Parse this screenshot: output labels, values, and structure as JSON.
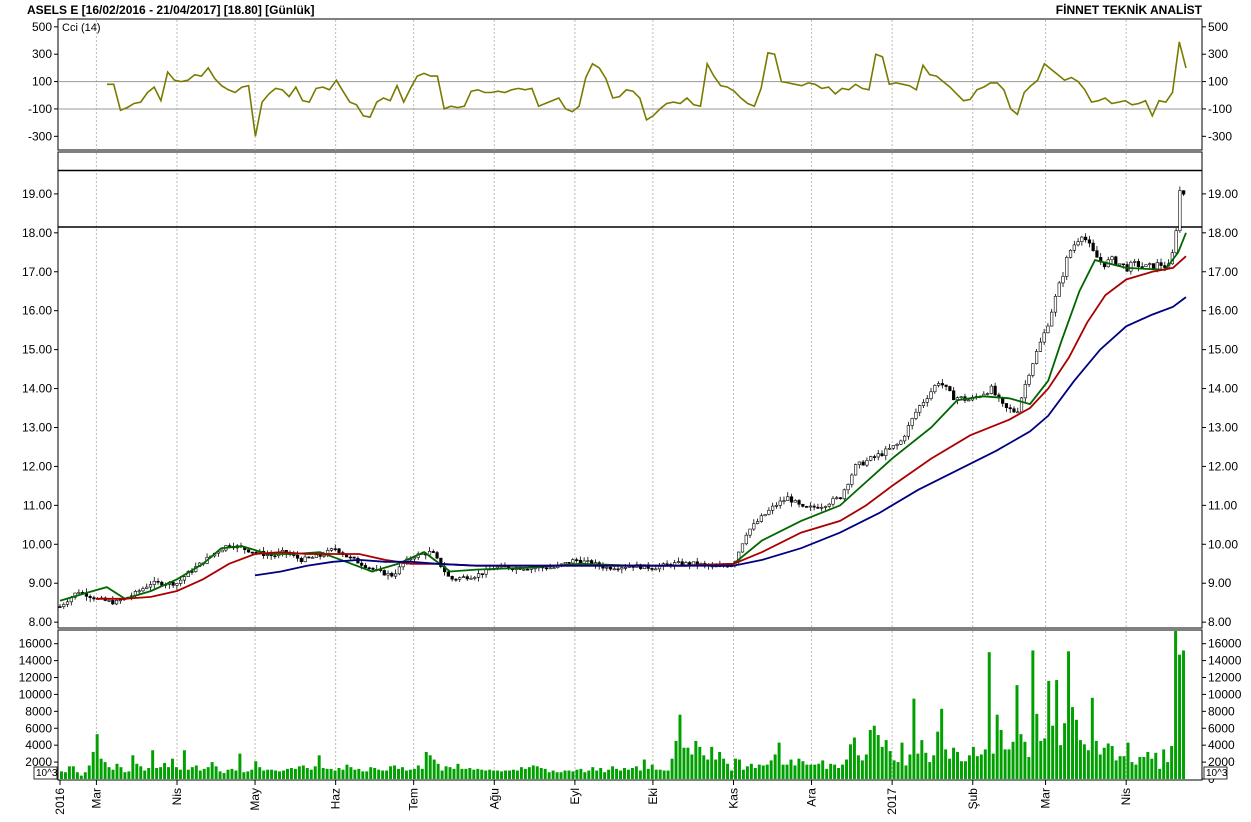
{
  "header": {
    "title": "ASELS E  [16/02/2016 - 21/04/2017]  [18.80]  [Günlük]",
    "brand": "FİNNET TEKNİK ANALİST"
  },
  "chart_data": [
    {
      "type": "line",
      "title": "Cci (14)",
      "y_ticks": [
        "500",
        "300",
        "100",
        "-100",
        "-300"
      ],
      "ylim": [
        -400,
        550
      ],
      "reference_lines": [
        100,
        -100
      ],
      "series": [
        {
          "name": "Cci (14)",
          "color": "#7a7a00",
          "values": [
            80,
            80,
            -110,
            -90,
            -60,
            -50,
            20,
            60,
            -40,
            170,
            110,
            100,
            110,
            150,
            140,
            200,
            120,
            70,
            40,
            20,
            60,
            70,
            -300,
            -50,
            10,
            50,
            40,
            -10,
            60,
            -40,
            -50,
            50,
            60,
            40,
            110,
            30,
            -50,
            -70,
            -150,
            -160,
            -50,
            -20,
            -40,
            70,
            -50,
            50,
            140,
            160,
            140,
            140,
            -100,
            -80,
            -90,
            -80,
            30,
            40,
            20,
            20,
            30,
            20,
            40,
            50,
            40,
            50,
            -80,
            -60,
            -40,
            -20,
            -100,
            -120,
            -80,
            130,
            230,
            200,
            120,
            -20,
            -10,
            40,
            30,
            -20,
            -180,
            -150,
            -100,
            -60,
            -50,
            -60,
            -20,
            -70,
            -80,
            230,
            140,
            70,
            60,
            30,
            -20,
            -60,
            -80,
            50,
            310,
            300,
            100,
            90,
            80,
            70,
            90,
            80,
            50,
            60,
            10,
            50,
            40,
            80,
            50,
            40,
            300,
            280,
            80,
            90,
            80,
            70,
            40,
            220,
            150,
            140,
            100,
            60,
            10,
            -40,
            -30,
            40,
            60,
            90,
            90,
            40,
            -100,
            -140,
            20,
            70,
            110,
            230,
            190,
            150,
            110,
            130,
            100,
            40,
            -50,
            -40,
            -20,
            -60,
            -50,
            -40,
            -70,
            -60,
            -40,
            -150,
            -40,
            -50,
            20,
            390,
            200
          ]
        }
      ]
    },
    {
      "type": "line",
      "y_ticks": [
        "19.00",
        "18.00",
        "17.00",
        "16.00",
        "15.00",
        "14.00",
        "13.00",
        "12.00",
        "11.00",
        "10.00",
        "9.00",
        "8.00"
      ],
      "ylim": [
        7.85,
        20.05
      ],
      "x_tick_labels": [
        "2016",
        "Mar",
        "Nis",
        "May",
        "Haz",
        "Tem",
        "Ağu",
        "Eyl",
        "Eki",
        "Kas",
        "Ara",
        "2017",
        "Şub",
        "Mar",
        "Nis"
      ],
      "x_tick_days": [
        0,
        14,
        45,
        75,
        106,
        136,
        167,
        198,
        228,
        259,
        289,
        320,
        351,
        379,
        410
      ],
      "horizontal_lines": [
        19.6,
        18.15
      ],
      "close_series": {
        "days": [
          0,
          7,
          14,
          21,
          28,
          35,
          45,
          50,
          60,
          65,
          70,
          75,
          82,
          86,
          93,
          100,
          106,
          110,
          116,
          122,
          128,
          132,
          136,
          143,
          150,
          160,
          167,
          175,
          182,
          190,
          198,
          205,
          210,
          220,
          228,
          236,
          245,
          252,
          259,
          264,
          270,
          275,
          280,
          286,
          293,
          300,
          306,
          312,
          318,
          323,
          330,
          338,
          343,
          350,
          358,
          363,
          368,
          373,
          379,
          385,
          388,
          393,
          397,
          401,
          405,
          410,
          414,
          418,
          423,
          427,
          429,
          431,
          433
        ],
        "values": [
          8.4,
          8.8,
          8.6,
          8.5,
          8.7,
          9.0,
          9.0,
          9.3,
          9.8,
          10.0,
          9.9,
          9.8,
          9.7,
          9.8,
          9.6,
          9.7,
          9.9,
          9.7,
          9.5,
          9.3,
          9.2,
          9.5,
          9.7,
          9.8,
          9.1,
          9.2,
          9.4,
          9.4,
          9.4,
          9.4,
          9.6,
          9.5,
          9.4,
          9.45,
          9.4,
          9.5,
          9.5,
          9.4,
          9.5,
          10.3,
          10.7,
          11.0,
          11.2,
          10.9,
          11.0,
          11.2,
          12.0,
          12.2,
          12.4,
          12.6,
          13.5,
          14.2,
          13.8,
          13.7,
          14.0,
          13.5,
          13.4,
          14.5,
          15.5,
          16.8,
          17.5,
          18.0,
          17.5,
          17.2,
          17.3,
          17.1,
          17.2,
          17.1,
          17.2,
          17.1,
          18.0,
          19.3,
          18.8
        ]
      },
      "ma_series": [
        {
          "name": "",
          "color": "#006600",
          "days": [
            0,
            10,
            18,
            25,
            35,
            45,
            55,
            62,
            70,
            80,
            90,
            100,
            110,
            120,
            130,
            140,
            150,
            160,
            180,
            200,
            220,
            240,
            259,
            270,
            285,
            300,
            310,
            320,
            335,
            345,
            355,
            365,
            373,
            380,
            385,
            392,
            398,
            410,
            425,
            430,
            433
          ],
          "values": [
            8.55,
            8.75,
            8.9,
            8.6,
            8.8,
            9.1,
            9.5,
            9.9,
            9.95,
            9.75,
            9.75,
            9.8,
            9.55,
            9.3,
            9.5,
            9.8,
            9.3,
            9.35,
            9.4,
            9.5,
            9.45,
            9.45,
            9.5,
            10.1,
            10.6,
            11.0,
            11.6,
            12.2,
            13.0,
            13.7,
            13.8,
            13.75,
            13.6,
            14.2,
            15.2,
            16.5,
            17.3,
            17.1,
            17.05,
            17.5,
            18.0
          ]
        },
        {
          "name": "",
          "color": "#aa0000",
          "days": [
            14,
            25,
            35,
            45,
            55,
            65,
            75,
            85,
            95,
            105,
            115,
            125,
            135,
            145,
            160,
            180,
            200,
            220,
            240,
            259,
            270,
            285,
            300,
            310,
            320,
            335,
            350,
            365,
            373,
            380,
            388,
            395,
            402,
            410,
            420,
            428,
            433
          ],
          "values": [
            8.6,
            8.6,
            8.65,
            8.8,
            9.1,
            9.5,
            9.75,
            9.8,
            9.75,
            9.75,
            9.75,
            9.6,
            9.5,
            9.5,
            9.45,
            9.45,
            9.45,
            9.45,
            9.45,
            9.5,
            9.8,
            10.3,
            10.6,
            11.0,
            11.5,
            12.2,
            12.8,
            13.2,
            13.5,
            14.0,
            14.8,
            15.7,
            16.4,
            16.8,
            17.0,
            17.1,
            17.4
          ]
        },
        {
          "name": "",
          "color": "#000080",
          "days": [
            75,
            85,
            95,
            105,
            115,
            125,
            135,
            145,
            160,
            180,
            200,
            220,
            240,
            259,
            270,
            285,
            300,
            315,
            330,
            345,
            360,
            373,
            380,
            390,
            400,
            410,
            420,
            428,
            433
          ],
          "values": [
            9.2,
            9.3,
            9.45,
            9.55,
            9.6,
            9.55,
            9.55,
            9.5,
            9.45,
            9.45,
            9.45,
            9.45,
            9.45,
            9.45,
            9.6,
            9.9,
            10.3,
            10.8,
            11.4,
            11.9,
            12.4,
            12.9,
            13.3,
            14.2,
            15.0,
            15.6,
            15.9,
            16.1,
            16.35
          ]
        }
      ]
    },
    {
      "type": "bar",
      "y_unit": "10^3",
      "y_ticks": [
        "16000",
        "14000",
        "12000",
        "10000",
        "8000",
        "6000",
        "4000",
        "2000",
        "0"
      ],
      "ylim": [
        0,
        17500
      ],
      "color": "#00a000",
      "values": [
        900,
        800,
        1500,
        1500,
        800,
        400,
        800,
        1600,
        3200,
        5300,
        2400,
        2000,
        1400,
        1100,
        1800,
        1400,
        800,
        900,
        2800,
        1800,
        1500,
        1000,
        1300,
        3400,
        1300,
        1400,
        1900,
        1400,
        2400,
        1400,
        1100,
        3400,
        1100,
        1400,
        1600,
        1000,
        1200,
        1400,
        2000,
        1500,
        900,
        700,
        1100,
        1200,
        1000,
        3000,
        800,
        900,
        1100,
        2100,
        1400,
        1000,
        1100,
        1100,
        1000,
        900,
        1000,
        1200,
        1300,
        1200,
        1500,
        1600,
        1300,
        1100,
        1500,
        2800,
        1300,
        1200,
        1200,
        1000,
        1300,
        1100,
        1700,
        1400,
        1100,
        1200,
        900,
        900,
        1400,
        1300,
        1100,
        1000,
        1000,
        1500,
        1600,
        1200,
        1400,
        1000,
        1100,
        1200,
        1600,
        1200,
        3200,
        2800,
        2300,
        1800,
        1000,
        1500,
        1400,
        1200,
        1800,
        1200,
        1200,
        1300,
        1100,
        1200,
        1100,
        1000,
        1100,
        1000,
        1000,
        900,
        1000,
        1000,
        1100,
        1000,
        1400,
        1200,
        1400,
        1600,
        1500,
        1300,
        1200,
        800,
        1000,
        800,
        800,
        1000,
        1000,
        900,
        1100,
        1200,
        800,
        1000,
        1400,
        1000,
        1300,
        800,
        1100,
        1500,
        1200,
        1000,
        1300,
        1100,
        1300,
        1500,
        1000,
        2300,
        1200,
        1700,
        1100,
        1100,
        1000,
        1000,
        2400,
        4500,
        7600,
        3700,
        3700,
        2900,
        4500,
        3800,
        2800,
        2300,
        3800,
        2300,
        3200,
        2400,
        1800,
        1000,
        2400,
        2300,
        1100,
        1500,
        1800,
        1300,
        1700,
        1600,
        1700,
        2200,
        2900,
        4300,
        1700,
        1700,
        2300,
        1600,
        2400,
        2100,
        1700,
        1700,
        1700,
        1800,
        2200,
        1200,
        1800,
        1700,
        1300,
        1700,
        2300,
        4100,
        4900,
        2800,
        2200,
        2900,
        5800,
        6300,
        5200,
        3800,
        4600,
        3300,
        2200,
        2000,
        4300,
        1600,
        2900,
        9500,
        3000,
        4600,
        3100,
        2000,
        2800,
        5600,
        8300,
        3500,
        2400,
        3700,
        3200,
        2100,
        2100,
        2800,
        3800,
        2700,
        2900,
        3500,
        15000,
        3000,
        7600,
        5800,
        3500,
        3500,
        4400,
        11100,
        5300,
        4400,
        2600,
        15200,
        7700,
        4500,
        4800,
        11600,
        6300,
        11700,
        4000,
        6600,
        15100,
        8500,
        7000,
        4600,
        4100,
        3400,
        9600,
        4500,
        2900,
        3700,
        4200,
        3900,
        2200,
        2700,
        2700,
        4300,
        2000,
        1700,
        2600,
        2600,
        3200,
        2400,
        3100,
        1200,
        3500,
        2000,
        3900,
        17500,
        14700,
        15200
      ]
    }
  ]
}
